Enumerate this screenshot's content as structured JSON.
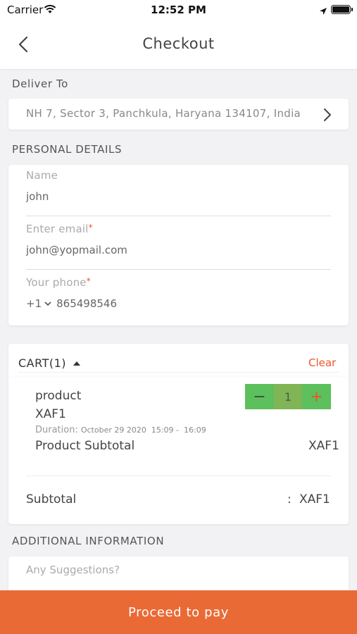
{
  "status_bar": {
    "carrier": "Carrier",
    "time": "12:52 PM"
  },
  "header": {
    "title": "Checkout",
    "back_icon": "chevron-left-icon"
  },
  "deliver": {
    "label": "Deliver To",
    "address": "NH 7, Sector 3, Panchkula, Haryana 134107, India"
  },
  "personal": {
    "section_label": "PERSONAL DETAILS",
    "name_label": "Name",
    "name_value": "john",
    "email_label": "Enter email",
    "email_value": "john@yopmail.com",
    "phone_label": "Your phone",
    "country_code": "+1",
    "phone_value": "865498546",
    "required_mark": "*"
  },
  "cart": {
    "header": "CART(1)",
    "clear_label": "Clear",
    "item": {
      "name": "product",
      "price": "XAF1",
      "duration_label": "Duration:",
      "duration_value": "October 29 2020  15:09 -  16:09",
      "subtotal_label": "Product Subtotal",
      "subtotal_value": "XAF1",
      "quantity": "1",
      "minus": "−",
      "plus": "+"
    },
    "subtotal_label": "Subtotal",
    "subtotal_colon": ":",
    "subtotal_value": "XAF1"
  },
  "additional": {
    "section_label": "ADDITIONAL INFORMATION",
    "placeholder": "Any Suggestions?"
  },
  "footer": {
    "pay_label": "Proceed to pay"
  },
  "colors": {
    "accent": "#ea6a35",
    "stepper_green": "#5cc05c",
    "stepper_qty": "#7fb554",
    "clear": "#e8572a"
  }
}
